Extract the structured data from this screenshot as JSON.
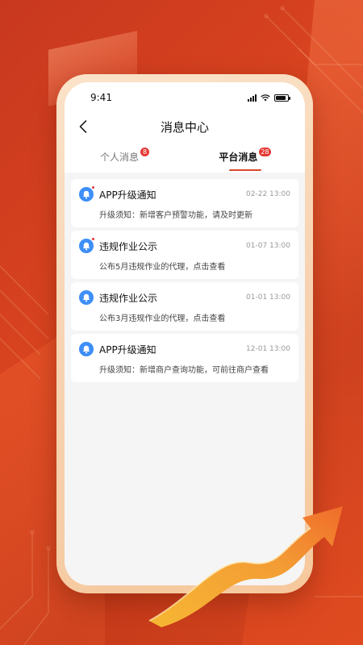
{
  "status": {
    "time": "9:41",
    "battery_level": 0.85
  },
  "header": {
    "title": "消息中心",
    "back_icon": "chevron-left-icon"
  },
  "tabs": [
    {
      "label": "个人消息",
      "badge": "8",
      "active": false
    },
    {
      "label": "平台消息",
      "badge": "28",
      "active": true
    }
  ],
  "messages": [
    {
      "title": "APP升级通知",
      "time": "02-22 13:00",
      "desc": "升级须知：新增客户预警功能，请及时更新",
      "unread": true
    },
    {
      "title": "违规作业公示",
      "time": "01-07 13:00",
      "desc": "公布5月违规作业的代理，点击查看",
      "unread": true
    },
    {
      "title": "违规作业公示",
      "time": "01-01 13:00",
      "desc": "公布3月违规作业的代理，点击查看",
      "unread": false
    },
    {
      "title": "APP升级通知",
      "time": "12-01 13:00",
      "desc": "升级须知：新增商户查询功能，可前往商户查看",
      "unread": false
    }
  ],
  "colors": {
    "accent": "#d84a2a",
    "bell": "#3e8ef7",
    "badge": "#e53935",
    "background": "#c8381f"
  }
}
